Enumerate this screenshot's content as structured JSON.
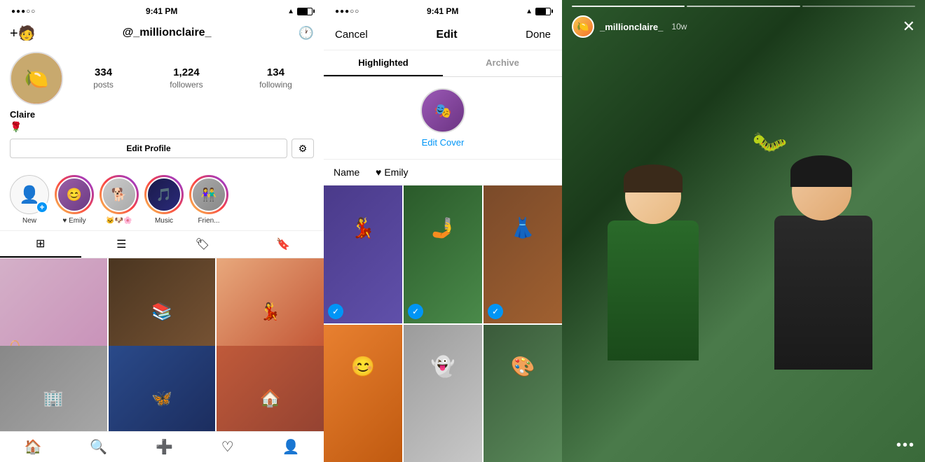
{
  "leftPhone": {
    "statusBar": {
      "dots": "●●●○○",
      "time": "9:41 PM",
      "battery": "80"
    },
    "nav": {
      "addUser": "+👤",
      "username": "@_millionclaire_",
      "history": "🕐"
    },
    "profile": {
      "name": "Claire",
      "emoji": "🌹",
      "posts": "334",
      "postsLabel": "posts",
      "followers": "1,224",
      "followersLabel": "followers",
      "following": "134",
      "followingLabel": "following"
    },
    "buttons": {
      "editProfile": "Edit Profile",
      "settings": "⚙"
    },
    "stories": [
      {
        "id": "new",
        "label": "New",
        "type": "new"
      },
      {
        "id": "emily",
        "label": "♥ Emily",
        "type": "story"
      },
      {
        "id": "animals",
        "label": "🐱🐶🌸",
        "type": "story"
      },
      {
        "id": "music",
        "label": "Music",
        "type": "story"
      },
      {
        "id": "friends",
        "label": "Frien...",
        "type": "story"
      }
    ],
    "tabs": [
      {
        "icon": "⊞",
        "active": true
      },
      {
        "icon": "≡",
        "active": false
      },
      {
        "icon": "👤",
        "active": false
      },
      {
        "icon": "🔖",
        "active": false
      }
    ],
    "bottomNav": [
      "🏠",
      "🔍",
      "➕",
      "♡",
      "👤"
    ]
  },
  "middlePhone": {
    "statusBar": {
      "dots": "●●●○○",
      "time": "9:41 PM",
      "battery": "80"
    },
    "header": {
      "cancel": "Cancel",
      "title": "Edit",
      "done": "Done"
    },
    "tabs": [
      "Highlighted",
      "Archive"
    ],
    "cover": {
      "editLabel": "Edit Cover"
    },
    "name": {
      "label": "Name",
      "heart": "♥",
      "value": "Emily"
    },
    "selectedPhotos": [
      0,
      1,
      2
    ]
  },
  "rightPanel": {
    "username": "_millionclaire_",
    "timeAgo": "10w",
    "moreIcon": "•••"
  }
}
